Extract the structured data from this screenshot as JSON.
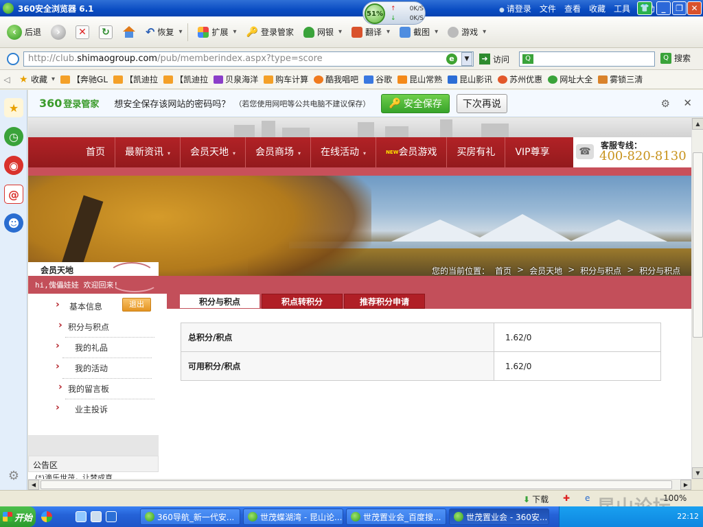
{
  "window": {
    "title": "360安全浏览器 6.1",
    "netmeter": {
      "percent": "51%",
      "up": "0K/S",
      "down": "0K/S"
    },
    "menu": [
      "请登录",
      "文件",
      "查看",
      "收藏",
      "工具",
      "帮助"
    ]
  },
  "toolbar": {
    "back": "后退",
    "restore": "恢复",
    "extend": "扩展",
    "login_manager": "登录管家",
    "netbank": "网银",
    "translate": "翻译",
    "screenshot": "截图",
    "games": "游戏"
  },
  "address": {
    "prefix": "http://club.",
    "host": "shimaogroup.com",
    "path": "/pub/memberindex.aspx?type=score",
    "visit": "访问",
    "search_btn": "搜索"
  },
  "favorites": [
    "收藏",
    "【奔驰GL",
    "【凯迪拉",
    "【凯迪拉",
    "贝泉海洋",
    "购车计算",
    "酷我唱吧",
    "谷歌",
    "昆山常熟",
    "昆山影讯",
    "苏州优惠",
    "网址大全",
    "雾锁三清"
  ],
  "password_bar": {
    "logo": "360",
    "logo_sub": "登录管家",
    "message": "想安全保存该网站的密码吗？",
    "note": "（若您使用网吧等公共电脑不建议保存）",
    "save": "安全保存",
    "later": "下次再说"
  },
  "site": {
    "nav": [
      "首页",
      "最新资讯",
      "会员天地",
      "会员商场",
      "在线活动",
      "会员游戏",
      "买房有礼",
      "VIP尊享"
    ],
    "nav_new_badge": "NEW",
    "hotline_label": "客服专线：",
    "hotline_number": "400-820-8130",
    "member_area": "会员天地",
    "breadcrumb": {
      "label": "您的当前位置：",
      "items": [
        "首页",
        "会员天地",
        "积分与积点",
        "积分与积点"
      ]
    },
    "welcome": "hi,傀儡娃娃 欢迎回来!",
    "left_menu": [
      "基本信息",
      "积分与积点",
      "我的礼品",
      "我的活动",
      "我的留言板",
      "业主投诉"
    ],
    "logout": "退出",
    "notice_title": "公告区",
    "notice_line": "(*)滴乐世茂，让梦成真",
    "tabs": [
      "积分与积点",
      "积点转积分",
      "推荐积分申请"
    ],
    "score_rows": [
      {
        "label": "总积分/积点",
        "value": "1.62/0"
      },
      {
        "label": "可用积分/积点",
        "value": "1.62/0"
      }
    ]
  },
  "statusbar": {
    "download": "下载",
    "zoom": "100%",
    "watermark": "昆山论坛 BBS"
  },
  "taskbar": {
    "start": "开始",
    "tasks": [
      "360导航_新一代安...",
      "世茂蝶湖湾 - 昆山论...",
      "世茂置业会_百度搜...",
      "世茂置业会 - 360安..."
    ],
    "clock": "22:12"
  }
}
